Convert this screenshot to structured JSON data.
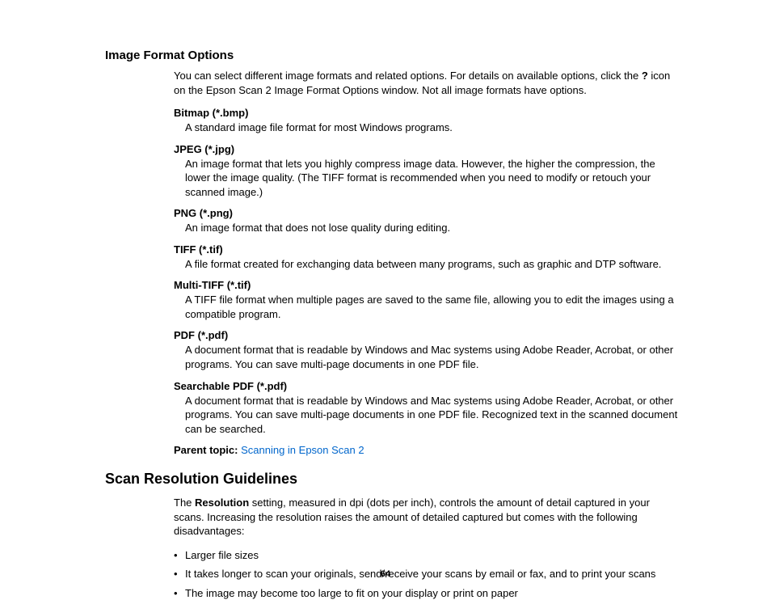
{
  "section1": {
    "heading": "Image Format Options",
    "intro_pre": "You can select different image formats and related options. For details on available options, click the ",
    "intro_bold": "?",
    "intro_post": " icon on the Epson Scan 2 Image Format Options window. Not all image formats have options.",
    "formats": [
      {
        "term": "Bitmap (*.bmp)",
        "desc": "A standard image file format for most Windows programs."
      },
      {
        "term": "JPEG (*.jpg)",
        "desc": "An image format that lets you highly compress image data. However, the higher the compression, the lower the image quality. (The TIFF format is recommended when you need to modify or retouch your scanned image.)"
      },
      {
        "term": "PNG (*.png)",
        "desc": "An image format that does not lose quality during editing."
      },
      {
        "term": "TIFF (*.tif)",
        "desc": "A file format created for exchanging data between many programs, such as graphic and DTP software."
      },
      {
        "term": "Multi-TIFF (*.tif)",
        "desc": "A TIFF file format when multiple pages are saved to the same file, allowing you to edit the images using a compatible program."
      },
      {
        "term": "PDF (*.pdf)",
        "desc": "A document format that is readable by Windows and Mac systems using Adobe Reader, Acrobat, or other programs. You can save multi-page documents in one PDF file."
      },
      {
        "term": "Searchable PDF (*.pdf)",
        "desc": "A document format that is readable by Windows and Mac systems using Adobe Reader, Acrobat, or other programs. You can save multi-page documents in one PDF file. Recognized text in the scanned document can be searched."
      }
    ],
    "parent_label": "Parent topic:",
    "parent_link": "Scanning in Epson Scan 2"
  },
  "section2": {
    "heading": "Scan Resolution Guidelines",
    "intro_pre": "The ",
    "intro_bold": "Resolution",
    "intro_post": " setting, measured in dpi (dots per inch), controls the amount of detail captured in your scans. Increasing the resolution raises the amount of detailed captured but comes with the following disadvantages:",
    "bullets": [
      "Larger file sizes",
      "It takes longer to scan your originals, send/receive your scans by email or fax, and to print your scans",
      "The image may become too large to fit on your display or print on paper"
    ]
  },
  "page_number": "64"
}
